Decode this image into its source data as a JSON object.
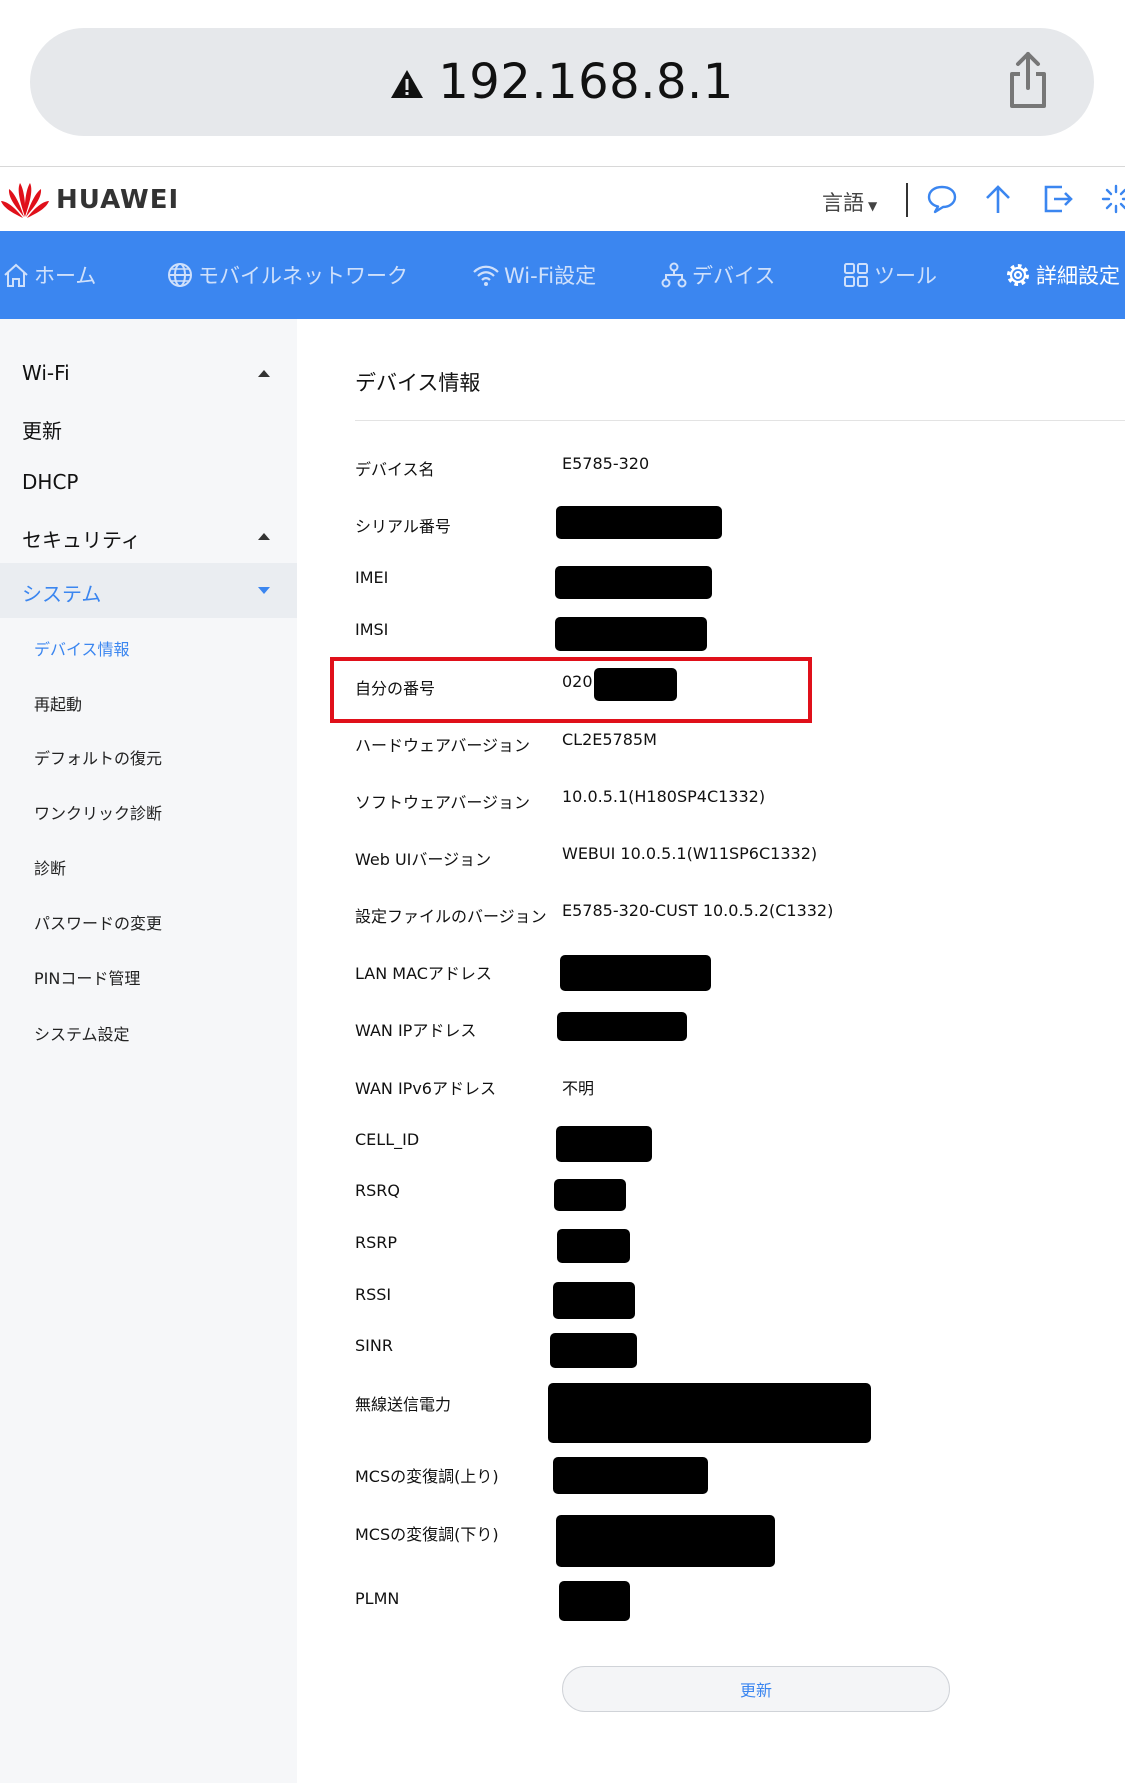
{
  "browser": {
    "url": "192.168.8.1"
  },
  "header": {
    "brand": "HUAWEI",
    "language_label": "言語"
  },
  "nav": {
    "items": [
      {
        "label": "ホーム",
        "icon": "home-icon"
      },
      {
        "label": "モバイルネットワーク",
        "icon": "globe-icon"
      },
      {
        "label": "Wi-Fi設定",
        "icon": "wifi-icon"
      },
      {
        "label": "デバイス",
        "icon": "devices-icon"
      },
      {
        "label": "ツール",
        "icon": "grid-icon"
      },
      {
        "label": "詳細設定",
        "icon": "gear-icon"
      }
    ],
    "active": "詳細設定"
  },
  "sidebar": {
    "groups": [
      {
        "label": "Wi-Fi",
        "state": "collapsed"
      },
      {
        "label": "更新"
      },
      {
        "label": "DHCP"
      },
      {
        "label": "セキュリティ",
        "state": "collapsed"
      },
      {
        "label": "システム",
        "state": "expanded",
        "active": true
      }
    ],
    "system_items": [
      {
        "label": "デバイス情報",
        "active": true
      },
      {
        "label": "再起動"
      },
      {
        "label": "デフォルトの復元"
      },
      {
        "label": "ワンクリック診断"
      },
      {
        "label": "診断"
      },
      {
        "label": "パスワードの変更"
      },
      {
        "label": "PINコード管理"
      },
      {
        "label": "システム設定"
      }
    ]
  },
  "main": {
    "title": "デバイス情報",
    "rows": [
      {
        "label": "デバイス名",
        "value": "E5785-320"
      },
      {
        "label": "シリアル番号",
        "value": ""
      },
      {
        "label": "IMEI",
        "value": ""
      },
      {
        "label": "IMSI",
        "value": ""
      },
      {
        "label": "自分の番号",
        "value": "020"
      },
      {
        "label": "ハードウェアバージョン",
        "value": "CL2E5785M"
      },
      {
        "label": "ソフトウェアバージョン",
        "value": "10.0.5.1(H180SP4C1332)"
      },
      {
        "label": "Web UIバージョン",
        "value": "WEBUI 10.0.5.1(W11SP6C1332)"
      },
      {
        "label": "設定ファイルのバージョン",
        "value": "E5785-320-CUST 10.0.5.2(C1332)"
      },
      {
        "label": "LAN MACアドレス",
        "value": ""
      },
      {
        "label": "WAN IPアドレス",
        "value": ""
      },
      {
        "label": "WAN IPv6アドレス",
        "value": "不明"
      },
      {
        "label": "CELL_ID",
        "value": ""
      },
      {
        "label": "RSRQ",
        "value": ""
      },
      {
        "label": "RSRP",
        "value": ""
      },
      {
        "label": "RSSI",
        "value": ""
      },
      {
        "label": "SINR",
        "value": ""
      },
      {
        "label": "無線送信電力",
        "value": ""
      },
      {
        "label": "MCSの変復調(上り)",
        "value": ""
      },
      {
        "label": "MCSの変復調(下り)",
        "value": ""
      },
      {
        "label": "PLMN",
        "value": ""
      }
    ],
    "refresh_label": "更新"
  },
  "colors": {
    "accent": "#3b86f0",
    "highlight": "#e0101a",
    "brand": "#e0101a"
  }
}
